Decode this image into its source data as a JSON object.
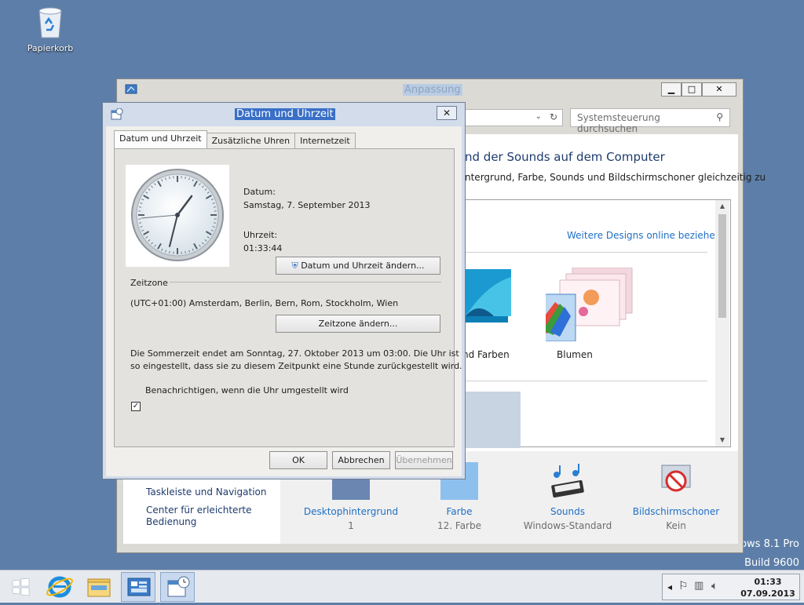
{
  "desktop": {
    "recycle_bin_label": "Papierkorb",
    "watermark_line1": "ows 8.1 Pro",
    "watermark_line2": "Build 9600"
  },
  "bg_window": {
    "title": "Anpassung",
    "search_placeholder": "Systemsteuerung durchsuchen",
    "heading_partial": "nd der Sounds auf dem Computer",
    "subtext_partial": "ntergrund, Farbe, Sounds und Bildschirmschoner gleichzeitig zu",
    "more_designs_link": "Weitere Designs online beziehen",
    "theme_partial_label": "nd Farben",
    "theme_label": "Blumen",
    "left_nav": [
      "Taskleiste und Navigation",
      "Center für erleichterte",
      "Bedienung"
    ],
    "bottom_items": [
      {
        "label": "Desktophintergrund",
        "value": "1"
      },
      {
        "label": "Farbe",
        "value": "12. Farbe"
      },
      {
        "label": "Sounds",
        "value": "Windows-Standard"
      },
      {
        "label": "Bildschirmschoner",
        "value": "Kein"
      }
    ]
  },
  "dialog": {
    "title": "Datum und Uhrzeit",
    "tabs": [
      "Datum und Uhrzeit",
      "Zusätzliche Uhren",
      "Internetzeit"
    ],
    "date_label": "Datum:",
    "date_value": "Samstag, 7. September 2013",
    "time_label": "Uhrzeit:",
    "time_value": "01:33:44",
    "change_datetime_button": "Datum und Uhrzeit ändern...",
    "timezone_group": "Zeitzone",
    "timezone_value": "(UTC+01:00) Amsterdam, Berlin, Bern, Rom, Stockholm, Wien",
    "change_timezone_button": "Zeitzone ändern...",
    "dst_line1": "Die Sommerzeit endet am Sonntag, 27. Oktober 2013 um 03:00. Die Uhr ist",
    "dst_line2": "so eingestellt, dass sie zu diesem Zeitpunkt eine Stunde zurückgestellt wird.",
    "notify_checkbox_label": "Benachrichtigen, wenn die Uhr umgestellt wird",
    "notify_checked": true,
    "ok_button": "OK",
    "cancel_button": "Abbrechen",
    "apply_button": "Übernehmen",
    "close_glyph": "✕"
  },
  "taskbar": {
    "time": "01:33",
    "date": "07.09.2013"
  },
  "colors": {
    "desktop": "#5d7ea8",
    "link": "#1f6fc5",
    "dialog_title_highlight": "#3a6fc7"
  }
}
